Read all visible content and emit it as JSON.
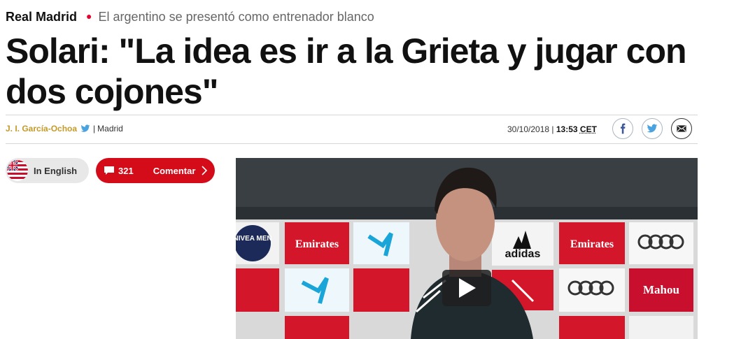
{
  "article": {
    "section": "Real Madrid",
    "kicker": "El argentino se presentó como entrenador blanco",
    "headline": "Solari: \"La idea es ir a la Grieta y jugar con dos cojones\"",
    "author": "J. I. García-Ochoa",
    "separator": "|",
    "location": "Madrid",
    "date": "30/10/2018",
    "time": "13:53",
    "timezone": "CET"
  },
  "share": {
    "icons": [
      "facebook-icon",
      "twitter-icon",
      "email-icon"
    ]
  },
  "actions": {
    "language_label": "In English",
    "comments_count": "321",
    "comment_label": "Comentar"
  },
  "video": {
    "sponsor_boards": [
      "NIVEA MEN",
      "Emirates",
      "adidas",
      "Emirates",
      "Mahou"
    ],
    "play_icon": "play-icon"
  },
  "colors": {
    "accent_red": "#d40b19",
    "author_gold": "#c49a2a",
    "twitter_blue": "#4aa3df"
  }
}
